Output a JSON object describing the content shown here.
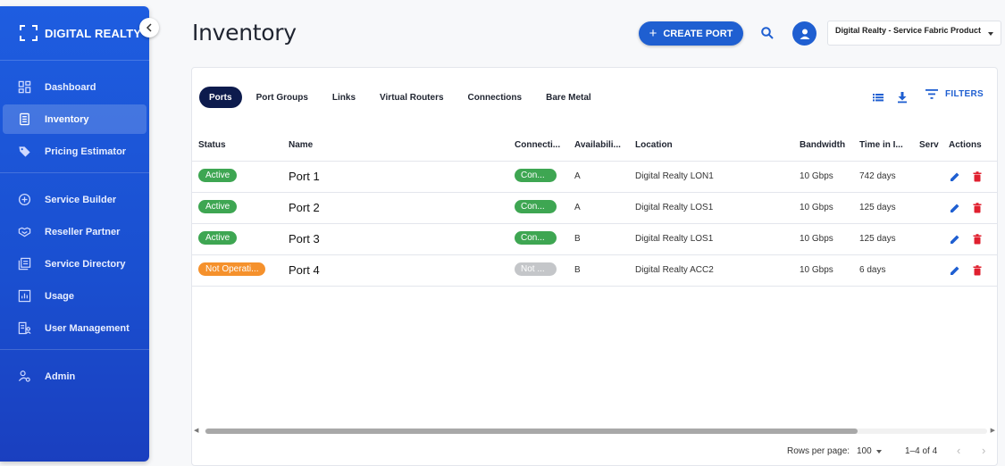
{
  "brand": {
    "name": "DIGITAL REALTY"
  },
  "sidebar": {
    "collapse_icon": "chevron-left-icon",
    "groups": [
      [
        {
          "label": "Dashboard",
          "icon": "dashboard-icon"
        },
        {
          "label": "Inventory",
          "icon": "inventory-icon",
          "active": true
        },
        {
          "label": "Pricing Estimator",
          "icon": "tag-icon"
        }
      ],
      [
        {
          "label": "Service Builder",
          "icon": "add-circle-icon"
        },
        {
          "label": "Reseller Partner",
          "icon": "handshake-icon"
        },
        {
          "label": "Service Directory",
          "icon": "directory-icon"
        },
        {
          "label": "Usage",
          "icon": "chart-icon"
        },
        {
          "label": "User Management",
          "icon": "user-management-icon"
        }
      ],
      [
        {
          "label": "Admin",
          "icon": "admin-icon"
        }
      ]
    ]
  },
  "header": {
    "title": "Inventory",
    "create_button": "CREATE PORT",
    "company": "Digital Realty - Service Fabric Product"
  },
  "tabs": [
    "Ports",
    "Port Groups",
    "Links",
    "Virtual Routers",
    "Connections",
    "Bare Metal"
  ],
  "toolbar": {
    "filters": "FILTERS"
  },
  "table": {
    "columns": [
      "Status",
      "Name",
      "Connecti...",
      "Availabili...",
      "Location",
      "Bandwidth",
      "Time in I...",
      "Serv",
      "Actions"
    ],
    "rows": [
      {
        "status": "Active",
        "status_color": "#3ea652",
        "name": "Port 1",
        "connection": "Con...",
        "connection_color": "#3ea652",
        "availability": "A",
        "location": "Digital Realty LON1",
        "bandwidth": "10 Gbps",
        "time": "742 days"
      },
      {
        "status": "Active",
        "status_color": "#3ea652",
        "name": "Port 2",
        "connection": "Con...",
        "connection_color": "#3ea652",
        "availability": "A",
        "location": "Digital Realty LOS1",
        "bandwidth": "10 Gbps",
        "time": "125 days"
      },
      {
        "status": "Active",
        "status_color": "#3ea652",
        "name": "Port 3",
        "connection": "Con...",
        "connection_color": "#3ea652",
        "availability": "B",
        "location": "Digital Realty LOS1",
        "bandwidth": "10 Gbps",
        "time": "125 days"
      },
      {
        "status": "Not Operati...",
        "status_color": "#f5912c",
        "name": "Port 4",
        "connection": "Not ...",
        "connection_color": "#c4c6c9",
        "availability": "B",
        "location": "Digital Realty ACC2",
        "bandwidth": "10 Gbps",
        "time": "6 days"
      }
    ]
  },
  "pagination": {
    "rows_per_page_label": "Rows per page:",
    "rows_per_page": "100",
    "range": "1–4 of 4"
  },
  "colors": {
    "primary": "#1f5fd1",
    "sidebar": "#1e5de0",
    "edit": "#1f5fd1",
    "delete": "#e0202f"
  }
}
